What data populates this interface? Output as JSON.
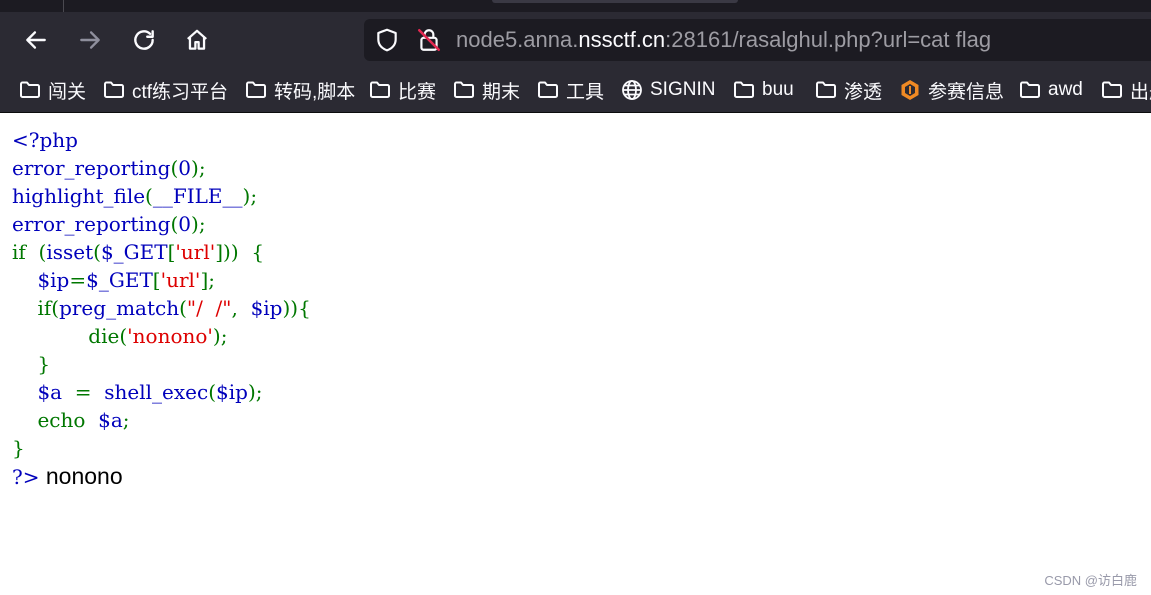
{
  "browser": {
    "url": {
      "prefix": "node5.anna.",
      "domain": "nssctf.cn",
      "suffix": ":28161/rasalghul.php?url=cat flag"
    },
    "bookmarks": [
      {
        "label": "闯关",
        "icon": "folder-icon"
      },
      {
        "label": "ctf练习平台",
        "icon": "folder-icon"
      },
      {
        "label": "转码,脚本",
        "icon": "folder-icon"
      },
      {
        "label": "比赛",
        "icon": "folder-icon"
      },
      {
        "label": "期末",
        "icon": "folder-icon"
      },
      {
        "label": "工具",
        "icon": "folder-icon"
      },
      {
        "label": "SIGNIN",
        "icon": "globe-icon"
      },
      {
        "label": "buu",
        "icon": "folder-icon"
      },
      {
        "label": "渗透",
        "icon": "folder-icon"
      },
      {
        "label": "参赛信息",
        "icon": "hexagon-logo-icon"
      },
      {
        "label": "awd",
        "icon": "folder-icon"
      },
      {
        "label": "出题",
        "icon": "folder-icon"
      }
    ]
  },
  "code": {
    "l1_open": "<?php",
    "l2_fn": "error_reporting",
    "l2_p1": "(",
    "l2_arg": "0",
    "l2_p2": ");",
    "l3_fn": "highlight_file",
    "l3_p1": "(",
    "l3_arg": "__FILE__",
    "l3_p2": ");",
    "l4_fn": "error_reporting",
    "l4_p1": "(",
    "l4_arg": "0",
    "l4_p2": ");",
    "l5_kw": "if",
    "l5_p1": "  (",
    "l5_fn": "isset",
    "l5_p2": "(",
    "l5_var": "$_GET",
    "l5_p3": "[",
    "l5_str": "'url'",
    "l5_p4": "]))  {",
    "l6_indent": "    ",
    "l6_var": "$ip",
    "l6_eq": "=",
    "l6_var2": "$_GET",
    "l6_p1": "[",
    "l6_str": "'url'",
    "l6_p2": "];",
    "l7_indent": "    ",
    "l7_kw": "if",
    "l7_p1": "(",
    "l7_fn": "preg_match",
    "l7_p2": "(",
    "l7_str": "\"/  /\"",
    "l7_p3": ",  ",
    "l7_var": "$ip",
    "l7_p4": ")){",
    "l8_indent": "            ",
    "l8_kw": "die",
    "l8_p1": "(",
    "l8_str": "'nonono'",
    "l8_p2": ");",
    "l9": "    }",
    "l10_indent": "    ",
    "l10_var": "$a",
    "l10_eq": "  =  ",
    "l10_fn": "shell_exec",
    "l10_p1": "(",
    "l10_var2": "$ip",
    "l10_p2": ");",
    "l11_indent": "    ",
    "l11_kw": "echo",
    "l11_sp": "  ",
    "l11_var": "$a",
    "l11_p1": ";",
    "l12": "}",
    "l13_close": "?>",
    "output": " nonono"
  },
  "watermark": "CSDN @访白鹿"
}
